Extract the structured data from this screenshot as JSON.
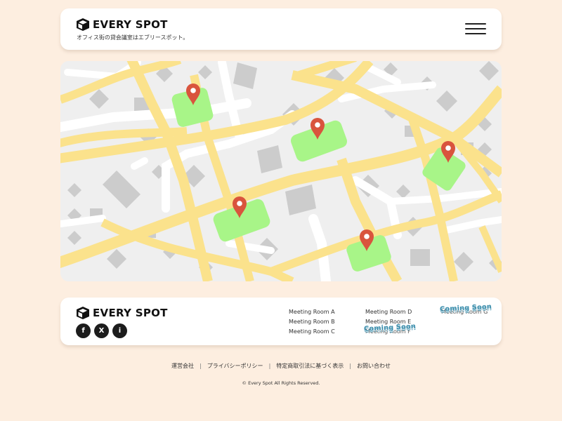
{
  "brand": {
    "name": "EVERY SPOT",
    "tagline": "オフィス街の貸会議室はエブリースポット。"
  },
  "header": {
    "menu_icon": "hamburger-menu-icon"
  },
  "map": {
    "pin_color": "#d9543d",
    "road_color": "#fbe28c",
    "park_color": "#a8f588",
    "building_color": "#cccccc",
    "background_color": "#efefef"
  },
  "footer": {
    "social": [
      {
        "name": "facebook",
        "glyph": "f"
      },
      {
        "name": "x",
        "glyph": "X"
      },
      {
        "name": "instagram",
        "glyph": "i"
      }
    ],
    "rooms": {
      "a": "Meeting Room A",
      "b": "Meeting Room B",
      "c": "Meeting Room C",
      "d": "Meeting Room D",
      "e": "Meeting Room E",
      "f": "Meeting Room F",
      "g": "Meeting Room G"
    },
    "coming_soon": "Coming Soon",
    "links": [
      "運営会社",
      "プライバシーポリシー",
      "特定商取引法に基づく表示",
      "お問い合わせ"
    ],
    "copyright": "© Every Spot All Rights Reserved."
  },
  "colors": {
    "page_background": "#fdeee0",
    "card_background": "#ffffff",
    "coming_soon": "#3d8fad"
  }
}
